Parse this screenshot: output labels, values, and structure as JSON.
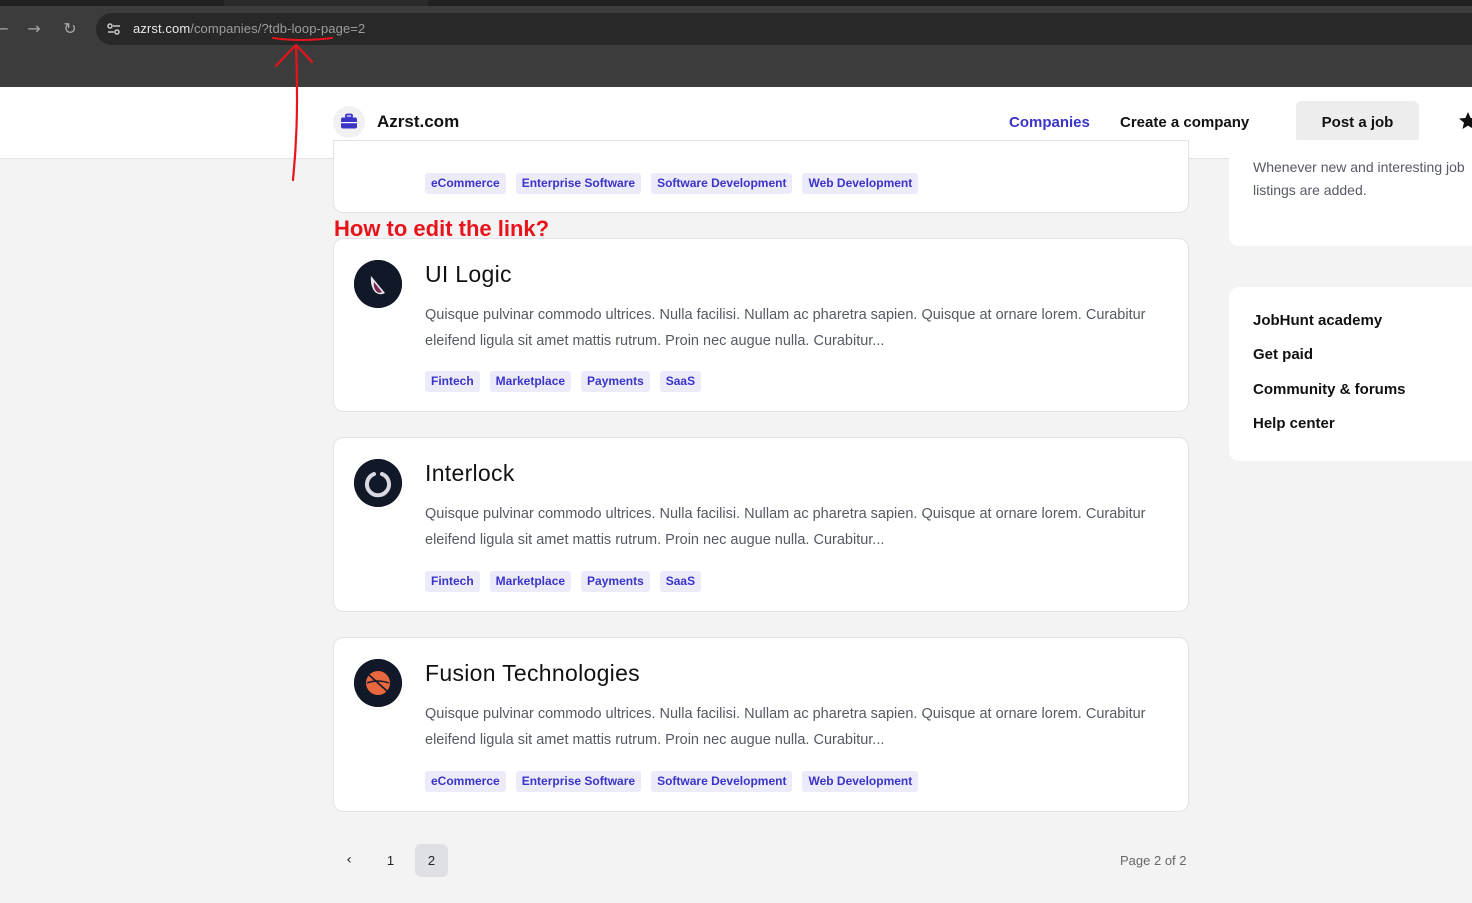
{
  "browser": {
    "url_host": "azrst.com",
    "url_path": "/companies/?tdb-loop-page=2"
  },
  "header": {
    "brand": "Azrst.com",
    "nav": {
      "companies": "Companies",
      "create": "Create a company"
    },
    "post_job": "Post a job"
  },
  "annotation": {
    "text": "How to edit the link?",
    "color": "#e8131b"
  },
  "cards": [
    {
      "tags": [
        "eCommerce",
        "Enterprise Software",
        "Software Development",
        "Web Development"
      ]
    },
    {
      "name": "UI Logic",
      "description": "Quisque pulvinar commodo ultrices. Nulla facilisi. Nullam ac pharetra sapien. Quisque at ornare lorem. Curabitur eleifend ligula sit amet mattis rutrum. Proin nec augue nulla. Curabitur...",
      "tags": [
        "Fintech",
        "Marketplace",
        "Payments",
        "SaaS"
      ]
    },
    {
      "name": "Interlock",
      "description": "Quisque pulvinar commodo ultrices. Nulla facilisi. Nullam ac pharetra sapien. Quisque at ornare lorem. Curabitur eleifend ligula sit amet mattis rutrum. Proin nec augue nulla. Curabitur...",
      "tags": [
        "Fintech",
        "Marketplace",
        "Payments",
        "SaaS"
      ]
    },
    {
      "name": "Fusion Technologies",
      "description": "Quisque pulvinar commodo ultrices. Nulla facilisi. Nullam ac pharetra sapien. Quisque at ornare lorem. Curabitur eleifend ligula sit amet mattis rutrum. Proin nec augue nulla. Curabitur...",
      "tags": [
        "eCommerce",
        "Enterprise Software",
        "Software Development",
        "Web Development"
      ]
    }
  ],
  "sidebar": {
    "notice": "Whenever new and interesting job listings are added.",
    "links": [
      "JobHunt academy",
      "Get paid",
      "Community & forums",
      "Help center"
    ]
  },
  "pagination": {
    "pages": [
      "1",
      "2"
    ],
    "current": "2",
    "status": "Page 2 of 2"
  },
  "colors": {
    "accent": "#3b34c8",
    "tag_bg": "#ecebfa",
    "page_bg": "#f3f3f4"
  }
}
